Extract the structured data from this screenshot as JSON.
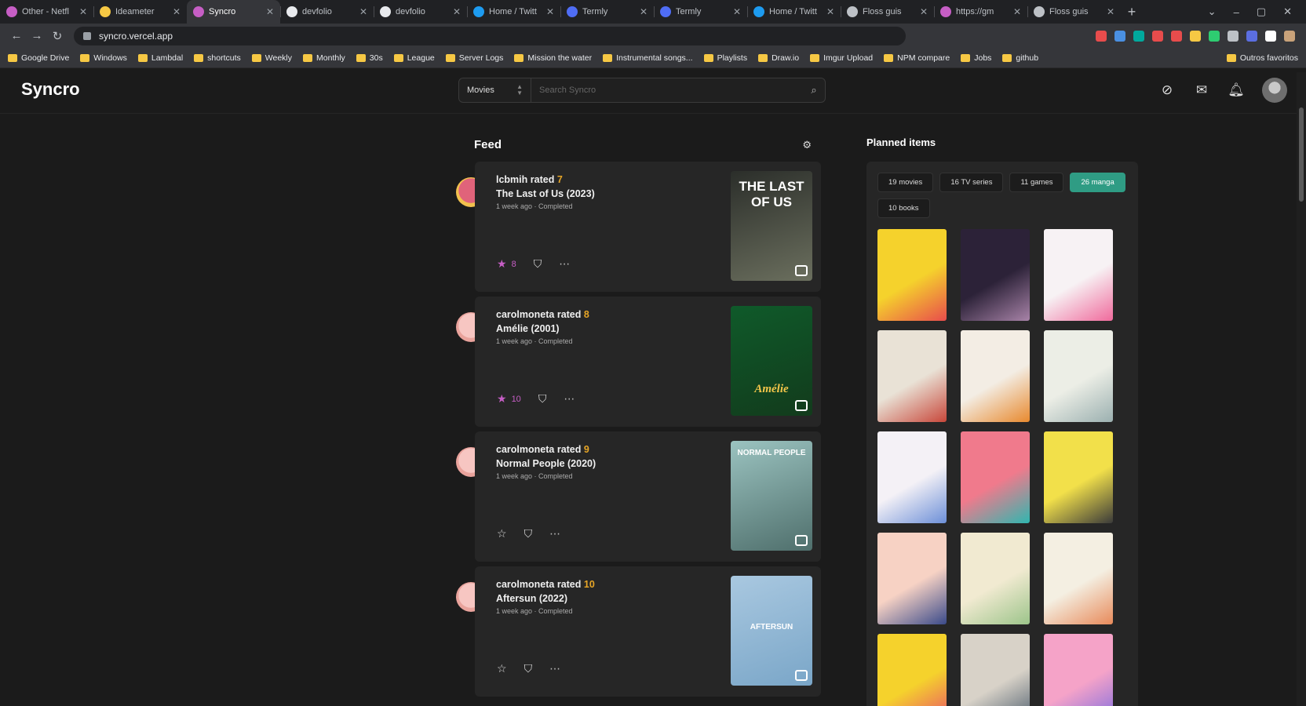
{
  "browser": {
    "tabs": [
      {
        "label": "Other - Netfl",
        "color": "#c65ec5",
        "active": false
      },
      {
        "label": "Ideameter",
        "color": "#f6c844",
        "active": false
      },
      {
        "label": "Syncro",
        "color": "#c65ec5",
        "active": true
      },
      {
        "label": "devfolio",
        "color": "#e8eaed",
        "active": false
      },
      {
        "label": "devfolio",
        "color": "#e8eaed",
        "active": false
      },
      {
        "label": "Home / Twitt",
        "color": "#1d9bf0",
        "active": false
      },
      {
        "label": "Termly",
        "color": "#4f6df5",
        "active": false
      },
      {
        "label": "Termly",
        "color": "#4f6df5",
        "active": false
      },
      {
        "label": "Home / Twitt",
        "color": "#1d9bf0",
        "active": false
      },
      {
        "label": "Floss guis",
        "color": "#bdc1c6",
        "active": false
      },
      {
        "label": "https://gm",
        "color": "#c65ec5",
        "active": false
      },
      {
        "label": "Floss guis",
        "color": "#bdc1c6",
        "active": false
      }
    ],
    "url": "syncro.vercel.app",
    "bookmarks": [
      "Google Drive",
      "Windows",
      "Lambdal",
      "shortcuts",
      "Weekly",
      "Monthly",
      "30s",
      "League",
      "Server Logs",
      "Mission the water",
      "Instrumental songs...",
      "Playlists",
      "Draw.io",
      "Imgur Upload",
      "NPM compare",
      "Jobs",
      "github"
    ],
    "bookmarks_right": "Outros favoritos",
    "extension_colors": [
      "#e84c4c",
      "#4a90e2",
      "#00a99d",
      "#e84c4c",
      "#e84c4c",
      "#f6c844",
      "#2ecc71",
      "#bdc1c6",
      "#5b6ee1",
      "#ffffff",
      "#c9a27a"
    ]
  },
  "app": {
    "logo": "Syncro",
    "search": {
      "category": "Movies",
      "placeholder": "Search Syncro"
    },
    "header_icons": [
      "explore-icon",
      "inbox-icon",
      "bell-icon"
    ]
  },
  "feed": {
    "title": "Feed",
    "items": [
      {
        "user": "lcbmih",
        "verb": "rated",
        "rating": "7",
        "title": "The Last of Us (2023)",
        "meta": "1 week ago · Completed",
        "starred": true,
        "star_count": "8",
        "poster_title": "THE LAST OF US",
        "avatar_colors": [
          "#e0637a",
          "#f2c14e"
        ],
        "poster_colors": [
          "#2b2e2a",
          "#6b6f5e"
        ]
      },
      {
        "user": "carolmoneta",
        "verb": "rated",
        "rating": "8",
        "title": "Amélie (2001)",
        "meta": "1 week ago · Completed",
        "starred": true,
        "star_count": "10",
        "poster_title": "Amélie",
        "avatar_colors": [
          "#f7c6c2",
          "#e9a39c"
        ],
        "poster_colors": [
          "#0f5a2a",
          "#123b1c"
        ]
      },
      {
        "user": "carolmoneta",
        "verb": "rated",
        "rating": "9",
        "title": "Normal People (2020)",
        "meta": "1 week ago · Completed",
        "starred": false,
        "star_count": "",
        "poster_title": "NORMAL PEOPLE",
        "avatar_colors": [
          "#f7c6c2",
          "#e9a39c"
        ],
        "poster_colors": [
          "#9bc3c0",
          "#4f6f6c"
        ]
      },
      {
        "user": "carolmoneta",
        "verb": "rated",
        "rating": "10",
        "title": "Aftersun (2022)",
        "meta": "1 week ago · Completed",
        "starred": false,
        "star_count": "",
        "poster_title": "AFTERSUN",
        "avatar_colors": [
          "#f7c6c2",
          "#e9a39c"
        ],
        "poster_colors": [
          "#a9c8e0",
          "#7aa6c8"
        ]
      }
    ]
  },
  "planned": {
    "title": "Planned items",
    "chips": [
      {
        "label": "19 movies",
        "active": false
      },
      {
        "label": "16 TV series",
        "active": false
      },
      {
        "label": "11 games",
        "active": false
      },
      {
        "label": "26 manga",
        "active": true
      },
      {
        "label": "10 books",
        "active": false
      }
    ],
    "covers": [
      [
        "#f5d22c",
        "#e84c4c"
      ],
      [
        "#2c2238",
        "#a883a8"
      ],
      [
        "#f7f2f4",
        "#f06a9c"
      ],
      [
        "#e9e2d6",
        "#c8473a"
      ],
      [
        "#f3ede4",
        "#e8892e"
      ],
      [
        "#eceee6",
        "#9bb0b0"
      ],
      [
        "#f4f1f6",
        "#6c8fd8"
      ],
      [
        "#f07a8c",
        "#2fb7b0"
      ],
      [
        "#f2e04a",
        "#3a3a3a"
      ],
      [
        "#f7d2c4",
        "#3a4a8a"
      ],
      [
        "#f1ead1",
        "#9cc48a"
      ],
      [
        "#f4efe2",
        "#e88a5a"
      ],
      [
        "#f5d22c",
        "#e84c6c"
      ],
      [
        "#d8d2c8",
        "#4a5a6a"
      ],
      [
        "#f5a3c8",
        "#7a6ae0"
      ]
    ]
  }
}
